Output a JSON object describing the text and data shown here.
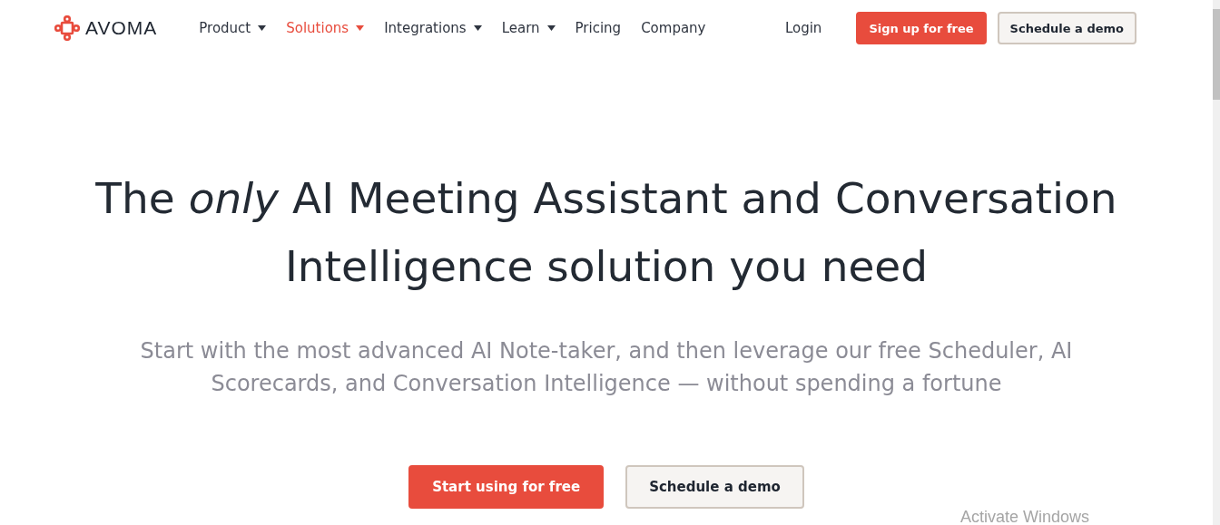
{
  "logo": {
    "text": "AVOMA"
  },
  "nav": [
    {
      "label": "Product",
      "dropdown": true,
      "selected": false
    },
    {
      "label": "Solutions",
      "dropdown": true,
      "selected": true
    },
    {
      "label": "Integrations",
      "dropdown": true,
      "selected": false
    },
    {
      "label": "Learn",
      "dropdown": true,
      "selected": false
    },
    {
      "label": "Pricing",
      "dropdown": false,
      "selected": false
    },
    {
      "label": "Company",
      "dropdown": false,
      "selected": false
    }
  ],
  "header_actions": [
    {
      "label": "Login",
      "kind": "link"
    },
    {
      "label": "Sign up for free",
      "kind": "primary"
    },
    {
      "label": "Schedule a demo",
      "kind": "secondary"
    }
  ],
  "hero": {
    "headline": "The *only* AI Meeting Assistant and Conversation Intelligence solution you need",
    "subtitle": "Start with the most advanced AI Note-taker, and then leverage our free Scheduler, AI Scorecards, and Conversation Intelligence — without spending a fortune",
    "buttons": [
      {
        "label": "Start using for free",
        "kind": "primary"
      },
      {
        "label": "Schedule a demo",
        "kind": "secondary"
      }
    ]
  },
  "os_notice": "Activate Windows"
}
